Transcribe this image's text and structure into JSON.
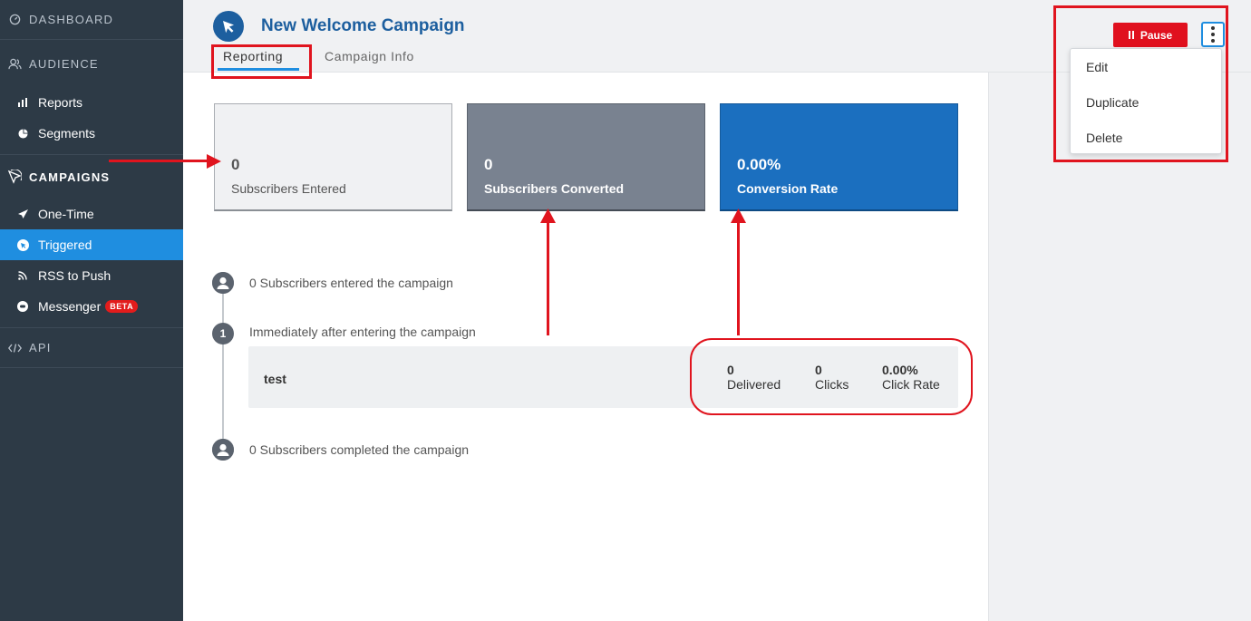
{
  "sidebar": {
    "dashboard": "DASHBOARD",
    "audience": "AUDIENCE",
    "audience_items": [
      {
        "label": "Reports",
        "icon": "bar-chart-icon"
      },
      {
        "label": "Segments",
        "icon": "pie-chart-icon"
      }
    ],
    "campaigns": "CAMPAIGNS",
    "campaign_items": [
      {
        "label": "One-Time",
        "icon": "send-icon"
      },
      {
        "label": "Triggered",
        "icon": "cursor-icon"
      },
      {
        "label": "RSS to Push",
        "icon": "rss-icon"
      },
      {
        "label": "Messenger",
        "icon": "messenger-icon",
        "badge": "BETA"
      }
    ],
    "api": "API"
  },
  "header": {
    "title": "New Welcome Campaign",
    "tabs": [
      "Reporting",
      "Campaign Info"
    ],
    "active_tab": "Reporting"
  },
  "actions": {
    "pause_label": "Pause",
    "menu_items": [
      "Edit",
      "Duplicate",
      "Delete"
    ]
  },
  "stats": [
    {
      "value": "0",
      "label": "Subscribers Entered"
    },
    {
      "value": "0",
      "label": "Subscribers Converted"
    },
    {
      "value": "0.00%",
      "label": "Conversion Rate"
    }
  ],
  "timeline": {
    "entered": "0 Subscribers entered the campaign",
    "step_number": "1",
    "step_label": "Immediately after entering the campaign",
    "message": {
      "name": "test",
      "delivered_value": "0",
      "delivered_label": "Delivered",
      "clicks_value": "0",
      "clicks_label": "Clicks",
      "click_rate_value": "0.00%",
      "click_rate_label": "Click Rate"
    },
    "completed": "0 Subscribers completed the campaign"
  },
  "colors": {
    "sidebar_bg": "#2d3a46",
    "accent": "#1f8ee0",
    "brand_blue": "#1d5f9f",
    "pause_red": "#e0101e",
    "annotation_red": "#e0141e"
  }
}
